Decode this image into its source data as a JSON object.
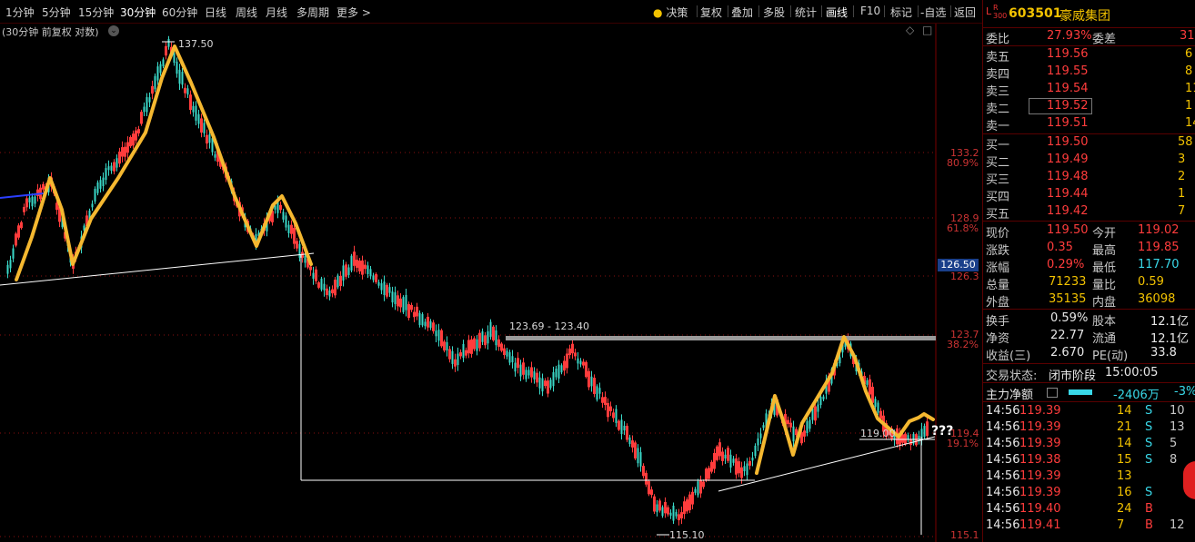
{
  "toolbar": {
    "periods": [
      "1分钟",
      "5分钟",
      "15分钟",
      "30分钟",
      "60分钟",
      "日线",
      "周线",
      "月线",
      "多周期",
      "更多 >"
    ],
    "tools": [
      "决策",
      "复权",
      "叠加",
      "多股",
      "统计",
      "画线",
      "F10",
      "标记",
      "-自选",
      "返回"
    ]
  },
  "chart": {
    "subtitle": "(30分钟 前复权 对数)",
    "axis_prices": [
      "133.2",
      "128.9",
      "126.3",
      "123.7",
      "119.4",
      "115.1"
    ],
    "axis_pcts": [
      "80.9%",
      "61.8%",
      "38.2%",
      "19.1%"
    ],
    "current_price_tag": "126.50",
    "high_label": "137.50",
    "low_label": "115.10",
    "range_label": "123.69 - 123.40",
    "price_mark": "119.00",
    "annotation": "???"
  },
  "chart_data": {
    "type": "candlestick",
    "title": "(30分钟 前复权 对数)",
    "high": 137.5,
    "low": 115.1,
    "resistance_range": [
      123.69,
      123.4
    ],
    "fib_levels": {
      "80.9%": 133.2,
      "61.8%": 128.9,
      "38.2%": 123.7,
      "19.1%": 119.4
    },
    "colors": {
      "up": "#ff3c3c",
      "down": "#3ad8c8",
      "pattern": "#f5b830",
      "trendline": "#ffffff",
      "resistance": "#9a9a9a"
    }
  },
  "quote": {
    "lr": "L",
    "lr_sub": "R",
    "lr_num": "300",
    "code": "603501",
    "name": "豪威集团",
    "weibi_label": "委比",
    "weibi": "27.93%",
    "weicha_label": "委差",
    "weicha": "31",
    "asks": [
      {
        "label": "卖五",
        "price": "119.56",
        "vol": "6"
      },
      {
        "label": "卖四",
        "price": "119.55",
        "vol": "8"
      },
      {
        "label": "卖三",
        "price": "119.54",
        "vol": "11"
      },
      {
        "label": "卖二",
        "price": "119.52",
        "vol": "1"
      },
      {
        "label": "卖一",
        "price": "119.51",
        "vol": "14"
      }
    ],
    "bids": [
      {
        "label": "买一",
        "price": "119.50",
        "vol": "58"
      },
      {
        "label": "买二",
        "price": "119.49",
        "vol": "3"
      },
      {
        "label": "买三",
        "price": "119.48",
        "vol": "2"
      },
      {
        "label": "买四",
        "price": "119.44",
        "vol": "1"
      },
      {
        "label": "买五",
        "price": "119.42",
        "vol": "7"
      }
    ],
    "stats": [
      {
        "l1": "现价",
        "v1": "119.50",
        "l2": "今开",
        "v2": "119.02"
      },
      {
        "l1": "涨跌",
        "v1": "0.35",
        "l2": "最高",
        "v2": "119.85"
      },
      {
        "l1": "涨幅",
        "v1": "0.29%",
        "l2": "最低",
        "v2": "117.70"
      },
      {
        "l1": "总量",
        "v1": "71233",
        "l2": "量比",
        "v2": "0.59"
      },
      {
        "l1": "外盘",
        "v1": "35135",
        "l2": "内盘",
        "v2": "36098"
      }
    ],
    "stats2": [
      {
        "l1": "换手",
        "v1": "0.59%",
        "l2": "股本",
        "v2": "12.1亿"
      },
      {
        "l1": "净资",
        "v1": "22.77",
        "l2": "流通",
        "v2": "12.1亿"
      },
      {
        "l1": "收益(三)",
        "v1": "2.670",
        "l2": "PE(动)",
        "v2": "33.8"
      }
    ],
    "status_label": "交易状态:",
    "status": "闭市阶段",
    "status_time": "15:00:05",
    "flow_label": "主力净额",
    "flow_value": "-2406万",
    "flow_pct": "-3%"
  },
  "trades": [
    {
      "time": "14:56",
      "price": "119.39",
      "vol": "14",
      "side": "S",
      "extra": "10"
    },
    {
      "time": "14:56",
      "price": "119.39",
      "vol": "21",
      "side": "S",
      "extra": "13"
    },
    {
      "time": "14:56",
      "price": "119.39",
      "vol": "14",
      "side": "S",
      "extra": "5"
    },
    {
      "time": "14:56",
      "price": "119.38",
      "vol": "15",
      "side": "S",
      "extra": "8"
    },
    {
      "time": "14:56",
      "price": "119.39",
      "vol": "13",
      "side": "",
      "extra": ""
    },
    {
      "time": "14:56",
      "price": "119.39",
      "vol": "16",
      "side": "S",
      "extra": ""
    },
    {
      "time": "14:56",
      "price": "119.40",
      "vol": "24",
      "side": "B",
      "extra": ""
    },
    {
      "time": "14:56",
      "price": "119.41",
      "vol": "7",
      "side": "B",
      "extra": "12"
    }
  ]
}
